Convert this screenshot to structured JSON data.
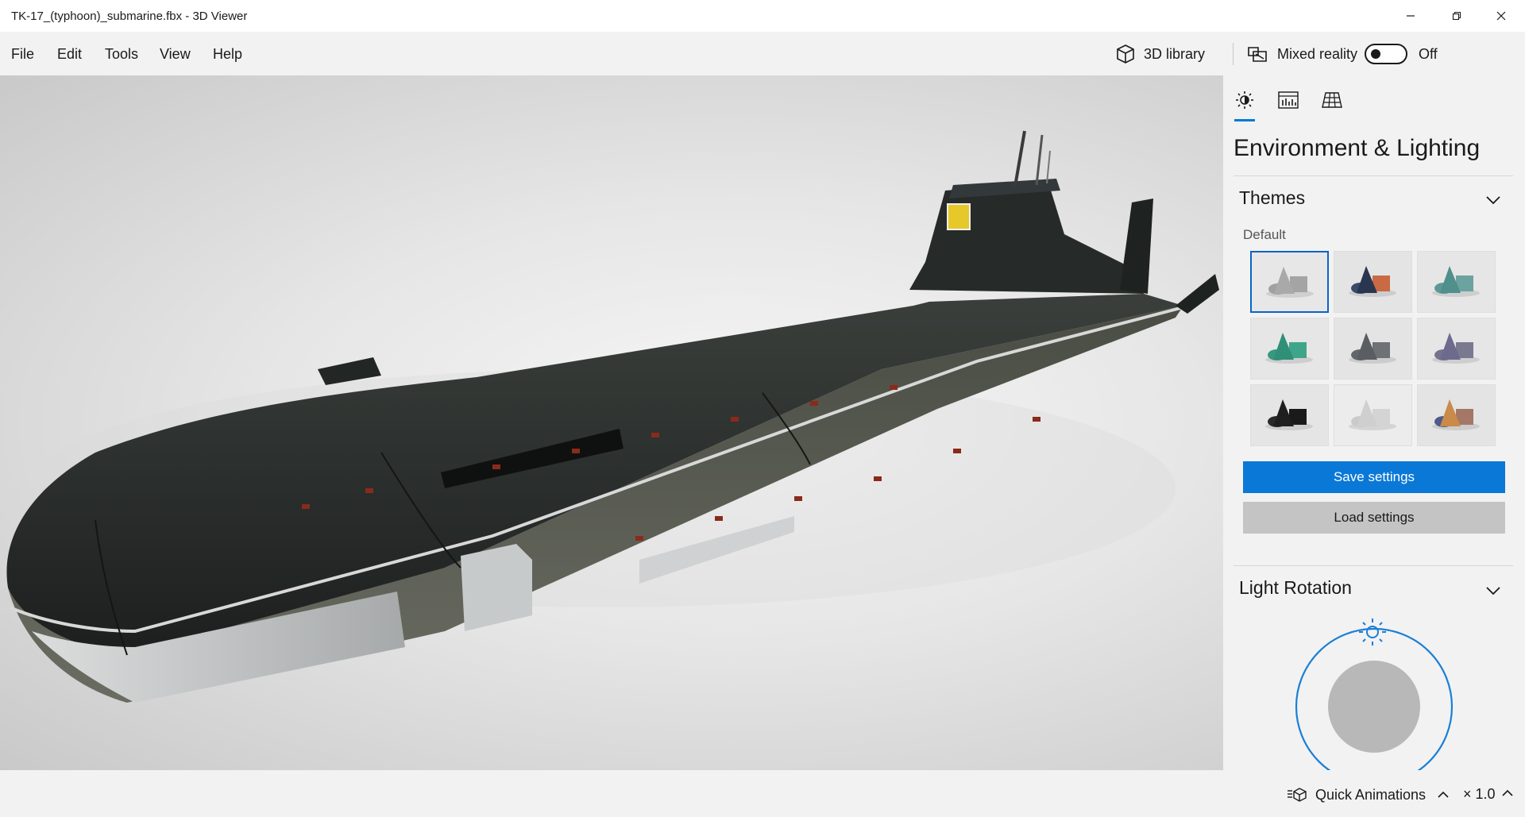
{
  "window": {
    "title": "TK-17_(typhoon)_submarine.fbx - 3D Viewer"
  },
  "menu": {
    "items": [
      "File",
      "Edit",
      "Tools",
      "View",
      "Help"
    ],
    "library_label": "3D library",
    "mixed_reality_label": "Mixed reality",
    "mixed_reality_state": "Off"
  },
  "panel": {
    "title": "Environment & Lighting",
    "themes": {
      "title": "Themes",
      "subtitle": "Default",
      "save_label": "Save settings",
      "load_label": "Load settings",
      "swatches": [
        {
          "selected": true,
          "bg": "#e7e7e7",
          "cone": "#a9a9a9",
          "cube": "#a4a4a4",
          "sphere": "#a0a0a0"
        },
        {
          "selected": false,
          "bg": "#e4e4e4",
          "cone": "#2a3550",
          "cube": "#c96a44",
          "sphere": "#3a4a6a"
        },
        {
          "selected": false,
          "bg": "#e6e6e6",
          "cone": "#4f8f8c",
          "cube": "#6aa3a0",
          "sphere": "#5e9896"
        },
        {
          "selected": false,
          "bg": "#e6e6e6",
          "cone": "#2f8f77",
          "cube": "#3fa58a",
          "sphere": "#36987f"
        },
        {
          "selected": false,
          "bg": "#e4e4e4",
          "cone": "#5a5e62",
          "cube": "#6e7276",
          "sphere": "#62666a"
        },
        {
          "selected": false,
          "bg": "#e6e6e6",
          "cone": "#6e6a8e",
          "cube": "#7b7990",
          "sphere": "#75728e"
        },
        {
          "selected": false,
          "bg": "#e5e5e5",
          "cone": "#1f1f1f",
          "cube": "#1a1a1a",
          "sphere": "#2a2a2a"
        },
        {
          "selected": false,
          "bg": "#ececec",
          "cone": "#cfcfcf",
          "cube": "#d4d4d4",
          "sphere": "#cacaca"
        },
        {
          "selected": false,
          "bg": "#e4e4e4",
          "cone": "#c98a4a",
          "cube": "#a57766",
          "sphere": "#4e5a8a"
        }
      ]
    },
    "light_rotation": {
      "title": "Light Rotation"
    }
  },
  "status": {
    "quick_animations_label": "Quick Animations",
    "speed": "× 1.0"
  },
  "colors": {
    "accent": "#0a78d7",
    "selected_border": "#0a64c8",
    "dial_ring": "#1a7fd6",
    "dial_knob": "#b8b8b8",
    "hull_dark": "#232725",
    "hull_light": "#b9bcbd"
  },
  "icons": {
    "minimize": "minimize-icon",
    "restore": "restore-icon",
    "close": "close-icon",
    "library": "cube-icon",
    "mixed_reality": "mixed-reality-icon",
    "tab_lighting": "sun-icon",
    "tab_stats": "stats-icon",
    "tab_grid": "grid-icon",
    "chevron": "chevron-down-icon",
    "sun": "sun-icon",
    "quick_animations": "animation-icon",
    "expand": "chevron-up-icon"
  }
}
